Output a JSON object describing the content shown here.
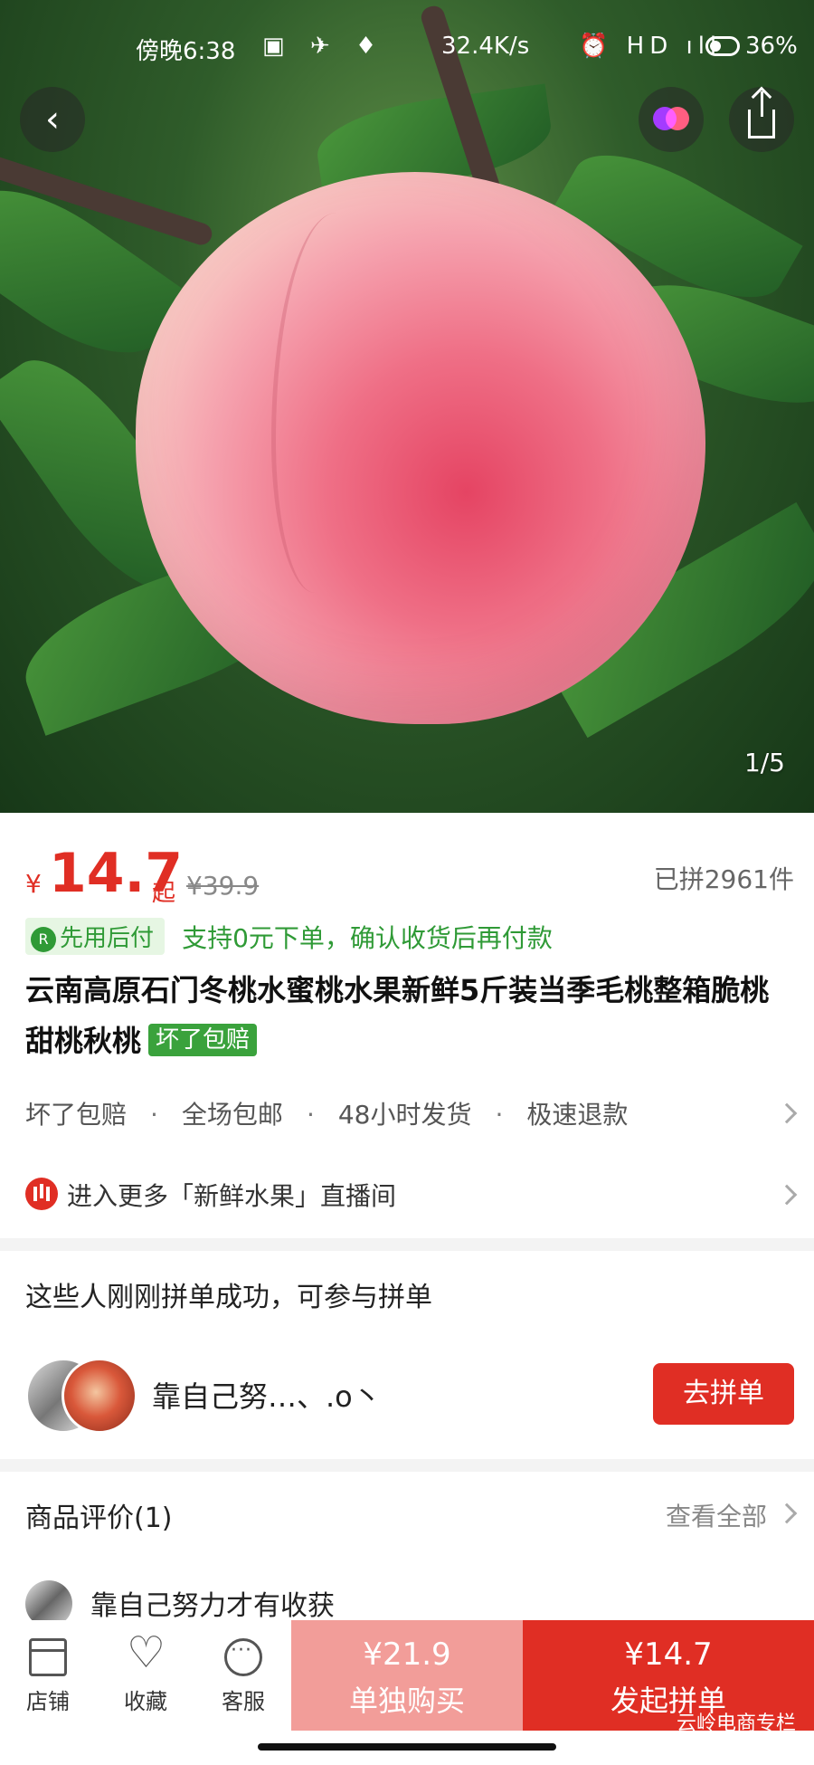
{
  "status_bar": {
    "time": "傍晚6:38",
    "net_speed": "32.4K/s",
    "battery": "36%"
  },
  "hero": {
    "counter": "1/5"
  },
  "price": {
    "currency": "¥",
    "current": "14.7",
    "suffix": "起",
    "original": "¥39.9",
    "sold": "已拼2961件"
  },
  "payment": {
    "badge": "先用后付",
    "badge_icon": "R",
    "text": "支持0元下单，确认收货后再付款"
  },
  "product": {
    "title": "云南高原石门冬桃水蜜桃水果新鲜5斤装当季毛桃整箱脆桃甜桃秋桃",
    "tag": "坏了包赔"
  },
  "services": [
    "坏了包赔",
    "全场包邮",
    "48小时发货",
    "极速退款"
  ],
  "service_separator": "·",
  "live": {
    "text": "进入更多「新鲜水果」直播间"
  },
  "group_buy": {
    "heading": "这些人刚刚拼单成功，可参与拼单",
    "user_name": "靠自己努…、.o丶",
    "join_label": "去拼单"
  },
  "reviews": {
    "heading": "商品评价(1)",
    "view_all": "查看全部",
    "first_user": "靠自己努力才有收获"
  },
  "bottom_bar": {
    "shop_label": "店铺",
    "fav_label": "收藏",
    "service_label": "客服",
    "solo_price": "¥21.9",
    "solo_label": "单独购买",
    "group_price": "¥14.7",
    "group_label": "发起拼单"
  },
  "watermark": "云岭电商专栏",
  "colors": {
    "accent": "#e02e24",
    "green": "#2f9a36",
    "solo_button": "#f29d99"
  }
}
